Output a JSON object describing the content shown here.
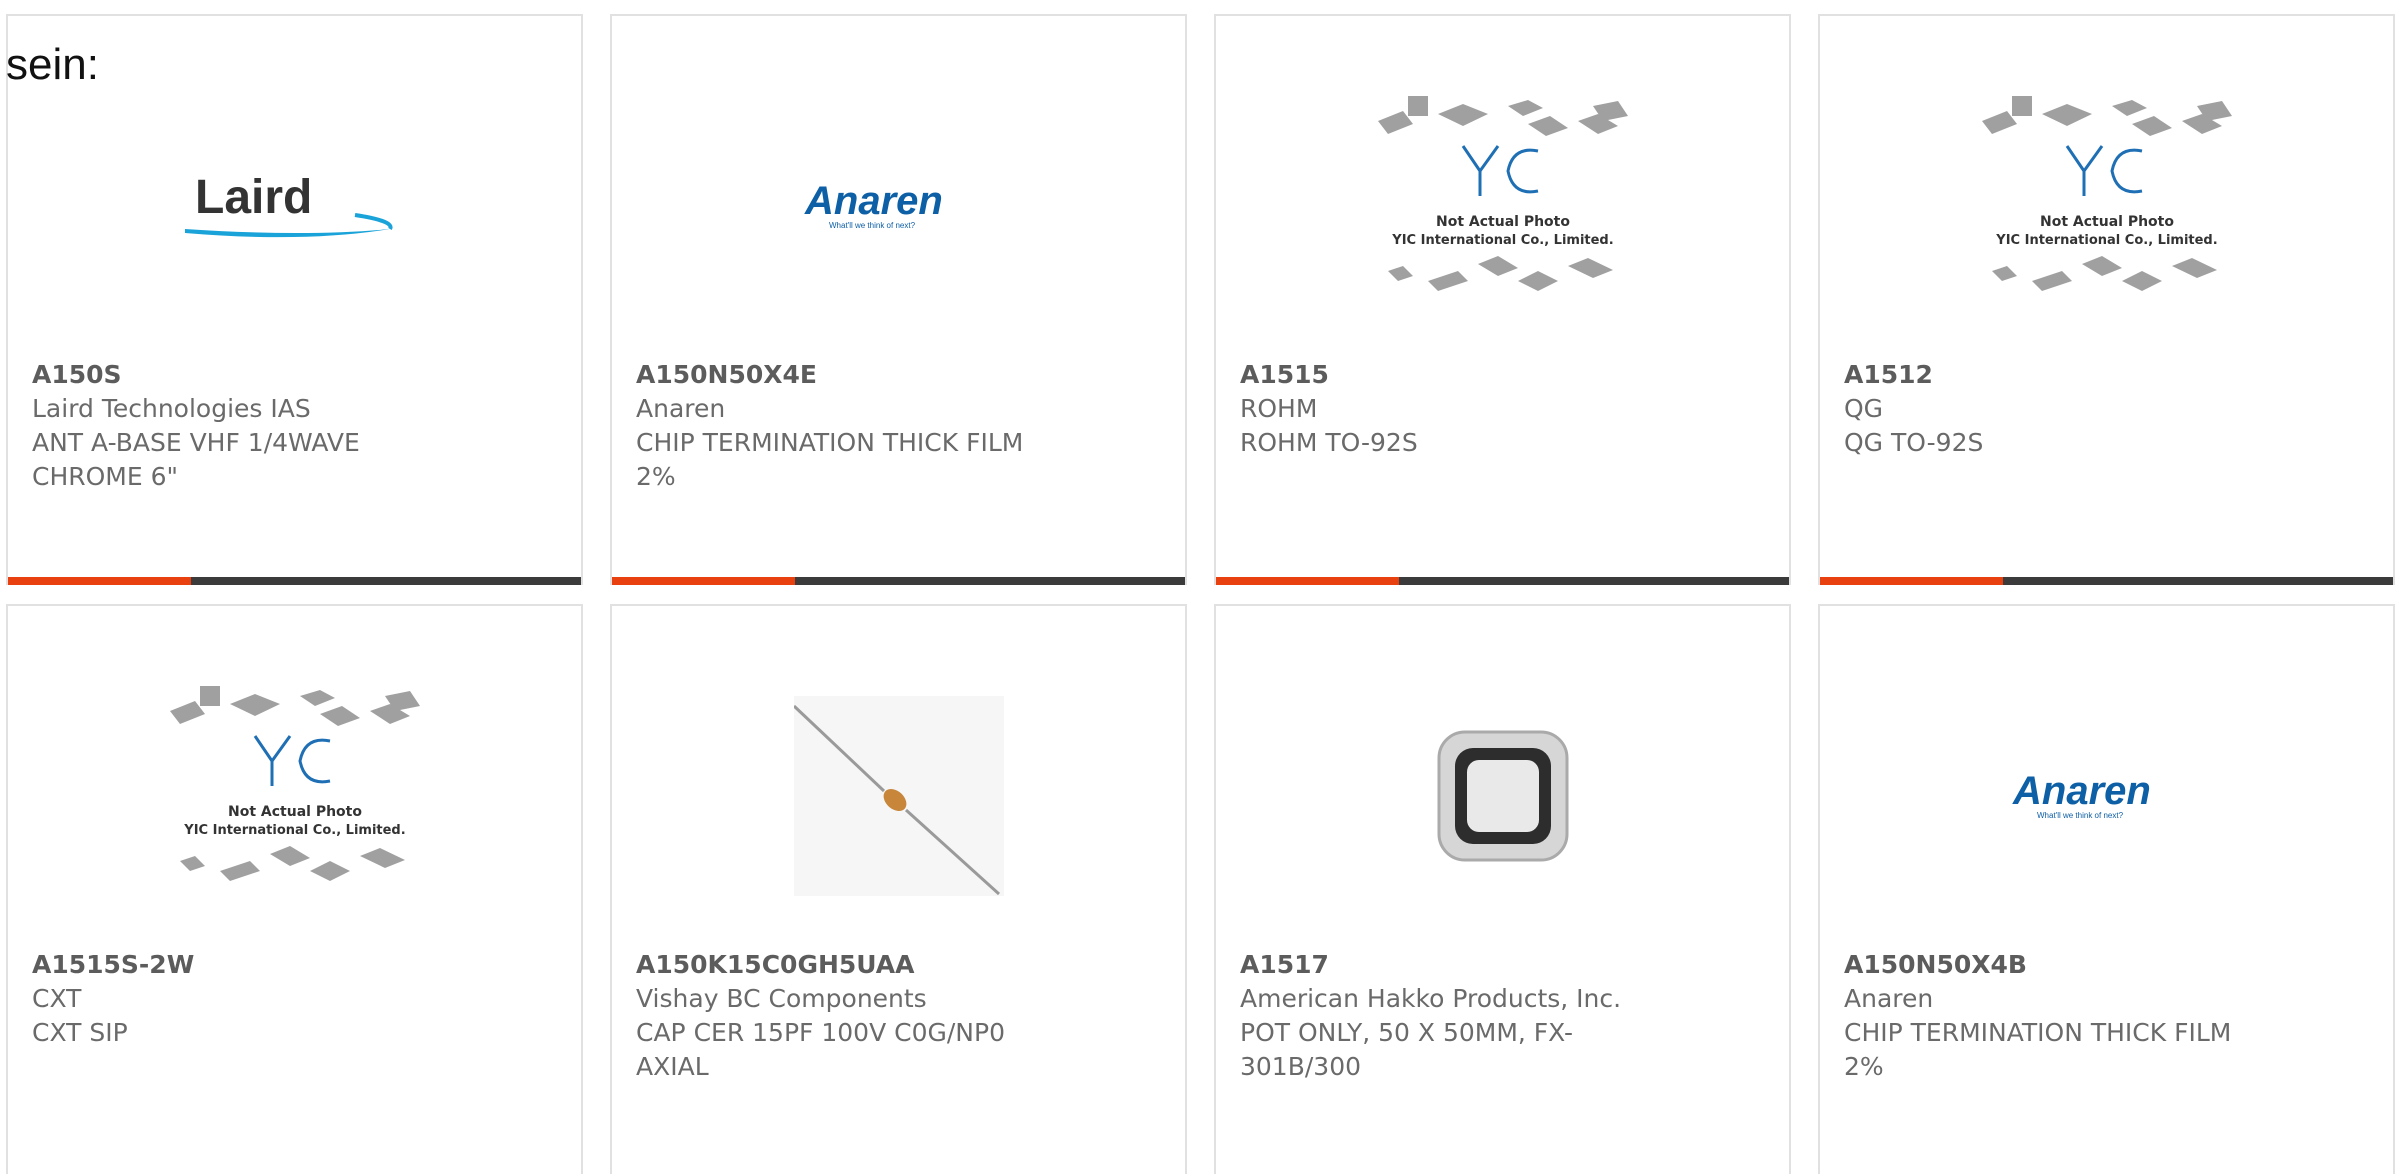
{
  "intro_text": "sein:",
  "colors": {
    "accent": "#e8400f",
    "bar": "#3b3b3b",
    "card_border": "#e1e1e1"
  },
  "placeholder": {
    "line1": "Not Actual Photo",
    "line2": "YIC International Co., Limited.",
    "mark": "YIC"
  },
  "logos": {
    "laird": "Laird",
    "anaren": "Anaren",
    "anaren_tag": "What'll we think of next?"
  },
  "cards": [
    {
      "part": "A150S",
      "maker": "Laird Technologies IAS",
      "desc": "ANT A-BASE VHF 1/4WAVE",
      "desc2": "CHROME 6\"",
      "image": "laird-logo"
    },
    {
      "part": "A150N50X4E",
      "maker": "Anaren",
      "desc": "CHIP TERMINATION THICK FILM",
      "desc2": "2%",
      "image": "anaren-logo"
    },
    {
      "part": "A1515",
      "maker": "ROHM",
      "desc": "ROHM TO-92S",
      "desc2": "",
      "image": "yic-placeholder"
    },
    {
      "part": "A1512",
      "maker": "QG",
      "desc": "QG TO-92S",
      "desc2": "",
      "image": "yic-placeholder"
    },
    {
      "part": "A1515S-2W",
      "maker": "CXT",
      "desc": "CXT SIP",
      "desc2": "",
      "image": "yic-placeholder"
    },
    {
      "part": "A150K15C0GH5UAA",
      "maker": "Vishay BC Components",
      "desc": "CAP CER 15PF 100V C0G/NP0",
      "desc2": "AXIAL",
      "image": "axial-capacitor-photo"
    },
    {
      "part": "A1517",
      "maker": "American Hakko Products, Inc.",
      "desc": "POT ONLY, 50 X 50MM, FX-",
      "desc2": "301B/300",
      "image": "solder-pot-photo"
    },
    {
      "part": "A150N50X4B",
      "maker": "Anaren",
      "desc": "CHIP TERMINATION THICK FILM",
      "desc2": "2%",
      "image": "anaren-logo"
    }
  ]
}
